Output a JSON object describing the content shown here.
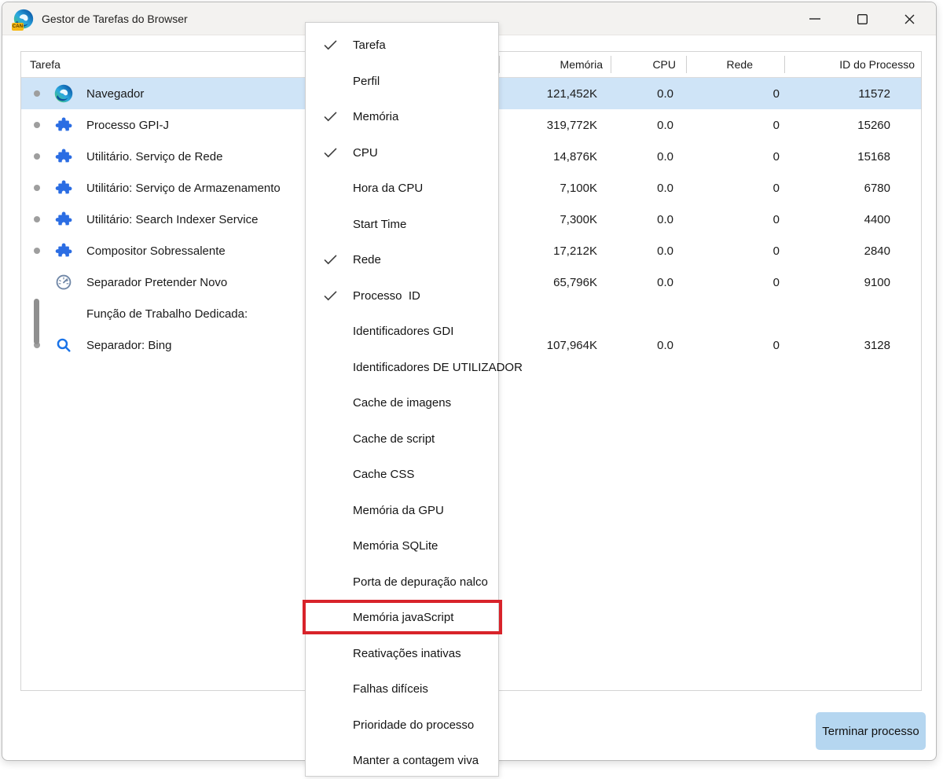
{
  "window": {
    "title": "Gestor de Tarefas do Browser",
    "icon_badge": "CAN",
    "titlebar_icons": [
      "minimize",
      "maximize",
      "close"
    ]
  },
  "table": {
    "columns": [
      "Tarefa",
      "Memória",
      "CPU",
      "Rede",
      "ID do Processo"
    ],
    "rows": [
      {
        "task": "Navegador",
        "icon": "edge",
        "bullet": "dot",
        "memoria": "121,452K",
        "cpu": "0.0",
        "rede": "0",
        "pid": "11572",
        "selected": true
      },
      {
        "task": "Processo GPI-J",
        "icon": "puzzle",
        "bullet": "dot",
        "memoria": "319,772K",
        "cpu": "0.0",
        "rede": "0",
        "pid": "15260",
        "selected": false
      },
      {
        "task": "Utilitário. Serviço de Rede",
        "icon": "puzzle",
        "bullet": "dot",
        "memoria": "14,876K",
        "cpu": "0.0",
        "rede": "0",
        "pid": "15168",
        "selected": false
      },
      {
        "task": "Utilitário: Serviço de Armazenamento",
        "icon": "puzzle",
        "bullet": "dot",
        "memoria": "7,100K",
        "cpu": "0.0",
        "rede": "0",
        "pid": "6780",
        "selected": false
      },
      {
        "task": "Utilitário: Search Indexer Service",
        "icon": "puzzle",
        "bullet": "dot",
        "memoria": "7,300K",
        "cpu": "0.0",
        "rede": "0",
        "pid": "4400",
        "selected": false
      },
      {
        "task": "Compositor Sobressalente",
        "icon": "puzzle",
        "bullet": "dot",
        "memoria": "17,212K",
        "cpu": "0.0",
        "rede": "0",
        "pid": "2840",
        "selected": false
      },
      {
        "task": "Separador Pretender Novo",
        "icon": "gauge",
        "bullet": "bar",
        "memoria": "65,796K",
        "cpu": "0.0",
        "rede": "0",
        "pid": "9100",
        "selected": false
      },
      {
        "task": "Função de Trabalho Dedicada:",
        "icon": null,
        "bullet": "none",
        "memoria": "",
        "cpu": "",
        "rede": "",
        "pid": "",
        "selected": false
      },
      {
        "task": "Separador: Bing",
        "icon": "search",
        "bullet": "dot",
        "memoria": "107,964K",
        "cpu": "0.0",
        "rede": "0",
        "pid": "3128",
        "selected": false
      }
    ]
  },
  "menu": {
    "items": [
      {
        "label": "Tarefa",
        "checked": true,
        "highlighted": false
      },
      {
        "label": "Perfil",
        "checked": false,
        "highlighted": false
      },
      {
        "label": "Memória",
        "checked": true,
        "highlighted": false
      },
      {
        "label": "CPU",
        "checked": true,
        "highlighted": false
      },
      {
        "label": "Hora da CPU",
        "checked": false,
        "highlighted": false
      },
      {
        "label": "Start Time",
        "checked": false,
        "highlighted": false
      },
      {
        "label": "Rede",
        "checked": true,
        "highlighted": false
      },
      {
        "label": "Processo  ID",
        "checked": true,
        "highlighted": false
      },
      {
        "label": "Identificadores GDI",
        "checked": false,
        "highlighted": false
      },
      {
        "label": "Identificadores DE UTILIZADOR",
        "checked": false,
        "highlighted": false
      },
      {
        "label": "Cache de imagens",
        "checked": false,
        "highlighted": false
      },
      {
        "label": "Cache de script",
        "checked": false,
        "highlighted": false
      },
      {
        "label": "Cache CSS",
        "checked": false,
        "highlighted": false
      },
      {
        "label": "Memória da GPU",
        "checked": false,
        "highlighted": false
      },
      {
        "label": "Memória SQLite",
        "checked": false,
        "highlighted": false
      },
      {
        "label": "Porta de depuração nalco",
        "checked": false,
        "highlighted": false
      },
      {
        "label": "Memória javaScript",
        "checked": false,
        "highlighted": true
      },
      {
        "label": "Reativações inativas",
        "checked": false,
        "highlighted": false
      },
      {
        "label": "Falhas difíceis",
        "checked": false,
        "highlighted": false
      },
      {
        "label": "Prioridade do processo",
        "checked": false,
        "highlighted": false
      },
      {
        "label": "Manter a contagem viva",
        "checked": false,
        "highlighted": false
      }
    ]
  },
  "footer": {
    "end_process_label": "Terminar processo"
  },
  "colors": {
    "titlebar_bg": "#f3f2f0",
    "selected_row": "#cfe4f7",
    "highlight_red": "#d8232a",
    "button_bg": "#b5d6f0",
    "puzzle_blue": "#2b6de3",
    "search_blue": "#1a73e8",
    "gauge_gray": "#6f86a6",
    "dot_gray": "#9e9e9e",
    "bar_gray": "#8f8f8f"
  }
}
